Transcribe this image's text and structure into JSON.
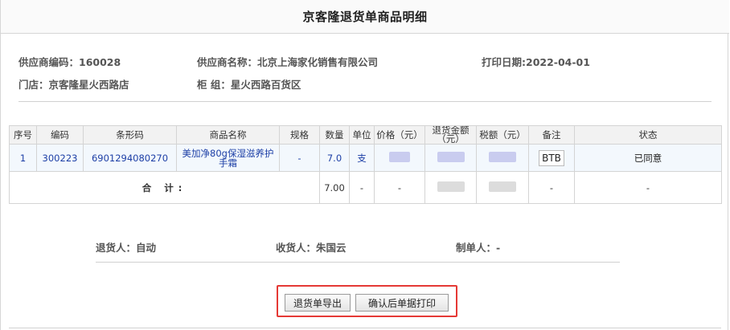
{
  "page": {
    "title": "京客隆退货单商品明细"
  },
  "info": {
    "supplier_code_label": "供应商编码：",
    "supplier_code": "160028",
    "supplier_name_label": "供应商名称：",
    "supplier_name": "北京上海家化销售有限公司",
    "print_date_label": "打印日期:",
    "print_date": "2022-04-01",
    "store_label": "门店：",
    "store": "京客隆星火西路店",
    "counter_label": "柜 组：",
    "counter": "星火西路百货区"
  },
  "table": {
    "headers": {
      "seq": "序号",
      "code": "编码",
      "barcode": "条形码",
      "name": "商品名称",
      "spec": "规格",
      "qty": "数量",
      "unit": "单位",
      "price": "价格（元）",
      "amount": "退货金额（元）",
      "tax": "税额（元）",
      "remark": "备注",
      "status": "状态"
    },
    "row": {
      "seq": "1",
      "code": "300223",
      "barcode": "6901294080270",
      "name": "美加净80g保湿滋养护手霜",
      "spec": "-",
      "qty": "7.0",
      "unit": "支",
      "remark": "BTB",
      "status": "已同意"
    },
    "total": {
      "label": "合 计:",
      "qty": "7.00",
      "unit": "-",
      "price": "-",
      "remark": "-",
      "status": "-"
    }
  },
  "sign": {
    "returner_label": "退货人：",
    "returner": "自动",
    "receiver_label": "收货人：",
    "receiver": "朱国云",
    "maker_label": "制单人：",
    "maker": "-"
  },
  "buttons": {
    "export": "退货单导出",
    "confirm_print": "确认后单据打印"
  },
  "colors": {
    "highlight_border": "#e53935",
    "data_text": "#1d3fa6",
    "row_bg": "#f3f8fd"
  }
}
